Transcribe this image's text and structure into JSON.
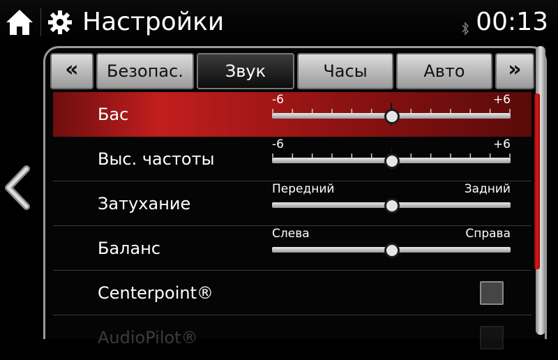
{
  "header": {
    "title": "Настройки",
    "time": "00:13",
    "home_icon": "home-icon",
    "settings_icon": "gear-icon",
    "status_icon": "bluetooth-icon"
  },
  "tabs": [
    {
      "label": "«",
      "kind": "prev-arrow"
    },
    {
      "label": "Безопас.",
      "active": false
    },
    {
      "label": "Звук",
      "active": true
    },
    {
      "label": "Часы",
      "active": false
    },
    {
      "label": "Авто",
      "active": false
    },
    {
      "label": "»",
      "kind": "next-arrow"
    }
  ],
  "rows": [
    {
      "label": "Бас",
      "type": "slider",
      "min_label": "-6",
      "max_label": "+6",
      "value": 0,
      "range": [
        -6,
        6
      ],
      "selected": true
    },
    {
      "label": "Выс. частоты",
      "type": "slider",
      "min_label": "-6",
      "max_label": "+6",
      "value": 0,
      "range": [
        -6,
        6
      ]
    },
    {
      "label": "Затухание",
      "type": "slider",
      "min_label": "Передний",
      "max_label": "Задний",
      "value": 0,
      "range": [
        -1,
        1
      ]
    },
    {
      "label": "Баланс",
      "type": "slider",
      "min_label": "Слева",
      "max_label": "Справа",
      "value": 0,
      "range": [
        -1,
        1
      ]
    },
    {
      "label": "Centerpoint®",
      "type": "checkbox",
      "checked": false
    },
    {
      "label": "AudioPilot®",
      "type": "checkbox",
      "checked": false,
      "faded": true
    }
  ],
  "colors": {
    "accent_red": "#c21e1e",
    "scrollbar_red": "#e01818",
    "background": "#000000"
  }
}
